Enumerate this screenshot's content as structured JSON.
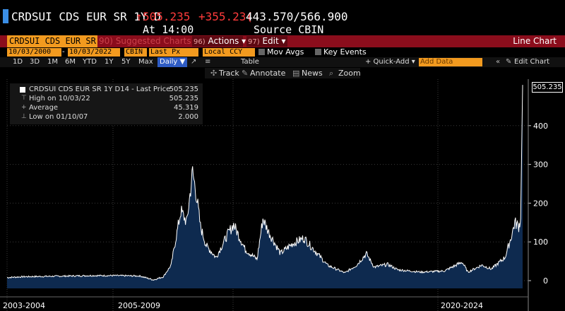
{
  "header": {
    "ticker": "CRDSUI CDS EUR SR 1Y D",
    "arrow": "↑",
    "price": "505.235",
    "change": "+355.23(",
    "range": "443.570/566.900",
    "time": "At 14:00",
    "source": "Source CBIN"
  },
  "toolbar": {
    "ticker_field": "CRDSUI CDS EUR SR",
    "suggested": "90) Suggested Charts",
    "actions_num": "96)",
    "actions": "Actions ▾",
    "edit_num": "97)",
    "edit": "Edit ▾",
    "view_label": "Line Chart"
  },
  "params": {
    "start_date": "10/03/2000",
    "dash": "-",
    "end_date": "10/03/2022",
    "source": "CBIN",
    "field": "Last Px",
    "currency": "Local CCY",
    "mov_avgs": "Mov Avgs",
    "key_events": "Key Events"
  },
  "ranges": {
    "items": [
      "1D",
      "3D",
      "1M",
      "6M",
      "YTD",
      "1Y",
      "5Y",
      "Max"
    ],
    "daily": "Daily ▼",
    "table": "Table",
    "quick_add": "+ Quick-Add ▾",
    "add_data_placeholder": "Add Data",
    "edit_chart": "Edit Chart"
  },
  "tools": {
    "track": "Track",
    "annotate": "Annotate",
    "news": "News",
    "zoom": "Zoom"
  },
  "legend": {
    "title": "CRDSUI CDS EUR SR 1Y D14 - Last Price",
    "title_value": "505.235",
    "high_label": "High on 10/03/22",
    "high_value": "505.235",
    "avg_label": "Average",
    "avg_value": "45.319",
    "low_label": "Low on 01/10/07",
    "low_value": "2.000"
  },
  "last_value_tag": "505.235",
  "colors": {
    "orange": "#f29a1f",
    "red_bar": "#8b0d1c",
    "price_red": "#ff3b3b",
    "area_fill": "#0e2a4f",
    "line": "#ffffff"
  },
  "chart_data": {
    "type": "area",
    "title": "CRDSUI CDS EUR SR 1Y D14 - Last Price",
    "ylim": [
      -20,
      520
    ],
    "yticks": [
      0,
      100,
      200,
      300,
      400
    ],
    "xtick_labels": [
      "2003-2004",
      "2005-2009",
      "2020-2024"
    ],
    "grid": true,
    "series": [
      {
        "name": "CRDSUI CDS EUR SR 1Y D14 - Last Price",
        "x": [
          "2000-10",
          "2001-06",
          "2002-06",
          "2003-06",
          "2004-06",
          "2005-06",
          "2006-06",
          "2007-01",
          "2007-06",
          "2007-10",
          "2008-03",
          "2008-06",
          "2008-09",
          "2008-11",
          "2009-01",
          "2009-04",
          "2009-09",
          "2010-03",
          "2010-06",
          "2010-12",
          "2011-06",
          "2011-09",
          "2011-12",
          "2012-06",
          "2012-12",
          "2013-06",
          "2014-06",
          "2015-03",
          "2015-09",
          "2016-02",
          "2016-06",
          "2017-01",
          "2017-06",
          "2018-06",
          "2019-06",
          "2020-03",
          "2020-06",
          "2021-01",
          "2021-06",
          "2022-01",
          "2022-04",
          "2022-06",
          "2022-08",
          "2022-09",
          "2022-10"
        ],
        "y": [
          8,
          10,
          11,
          12,
          13,
          13,
          12,
          2,
          10,
          40,
          180,
          150,
          280,
          220,
          140,
          90,
          60,
          120,
          145,
          80,
          55,
          160,
          125,
          70,
          95,
          110,
          40,
          20,
          40,
          70,
          35,
          42,
          28,
          22,
          25,
          48,
          22,
          40,
          30,
          60,
          110,
          150,
          140,
          160,
          505.235
        ]
      }
    ]
  }
}
